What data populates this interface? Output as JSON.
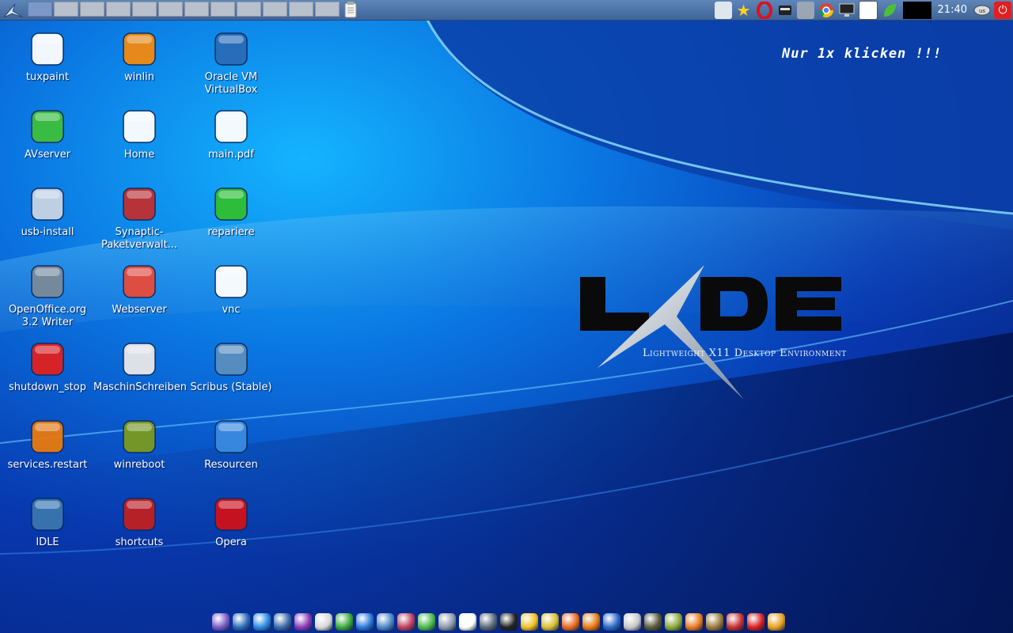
{
  "panel": {
    "pager_count": 12,
    "active_pager": 0,
    "clock": "21:40",
    "tray_icons": [
      "network-icon",
      "bookmark-star-icon",
      "opera-icon",
      "removable-drive-icon",
      "file-cabinet-icon",
      "chrome-icon",
      "display-icon",
      "cloud-icon",
      "leaf-icon",
      "system-monitor-icon",
      "language-icon",
      "power-icon"
    ]
  },
  "desktop": {
    "message": "Nur 1x klicken !!!",
    "logo_text": "LXDE",
    "logo_subtitle": "Lightweight X11 Desktop Environment",
    "icons": [
      {
        "label": "tuxpaint",
        "icon": "tux-penguin-icon",
        "color": "#ffffff"
      },
      {
        "label": "winlin",
        "icon": "worm-icon",
        "color": "#f08a10"
      },
      {
        "label": "Oracle VM VirtualBox",
        "icon": "virtualbox-cube-icon",
        "color": "#2a6cb8"
      },
      {
        "label": "AVserver",
        "icon": "green-folder-icon",
        "color": "#3cbf3c"
      },
      {
        "label": "Home",
        "icon": "house-icon",
        "color": "#ffffff"
      },
      {
        "label": "main.pdf",
        "icon": "document-icon",
        "color": "#ffffff"
      },
      {
        "label": "usb-install",
        "icon": "usb-stick-icon",
        "color": "#c8d4e4"
      },
      {
        "label": "Synaptic-Paketverwalt...",
        "icon": "package-manager-icon",
        "color": "#c03030"
      },
      {
        "label": "repariere",
        "icon": "dropper-icon",
        "color": "#2fbf2f"
      },
      {
        "label": "OpenOffice.org 3.2 Writer",
        "icon": "writer-doc-icon",
        "color": "#7a8a9a"
      },
      {
        "label": "Webserver",
        "icon": "red-folder-icon",
        "color": "#e84a3a"
      },
      {
        "label": "vnc",
        "icon": "vnc-icon",
        "color": "#ffffff"
      },
      {
        "label": "shutdown_stop",
        "icon": "shutdown-icon",
        "color": "#e02020"
      },
      {
        "label": "MaschinSchreiben",
        "icon": "keyboard-keys-icon",
        "color": "#e8e8e8"
      },
      {
        "label": "Scribus (Stable)",
        "icon": "scribus-icon",
        "color": "#5a8fc0"
      },
      {
        "label": "services.restart",
        "icon": "xfce-x-icon",
        "color": "#e87a10"
      },
      {
        "label": "winreboot",
        "icon": "circuit-board-icon",
        "color": "#7a9a20"
      },
      {
        "label": "Resourcen",
        "icon": "resource-folder-icon",
        "color": "#3a8ae0"
      },
      {
        "label": "IDLE",
        "icon": "python-icon",
        "color": "#3a76b0"
      },
      {
        "label": "shortcuts",
        "icon": "exit-door-icon",
        "color": "#c02020"
      },
      {
        "label": "Opera",
        "icon": "opera-icon",
        "color": "#d0101a"
      }
    ]
  },
  "dock": {
    "icons": [
      {
        "name": "browser-icon",
        "color": "#7a5ac8"
      },
      {
        "name": "virtualbox-icon",
        "color": "#2a6cb8"
      },
      {
        "name": "teamviewer-icon",
        "color": "#2a8ae0"
      },
      {
        "name": "network-icon",
        "color": "#3a6aa8"
      },
      {
        "name": "nvu-icon",
        "color": "#8a3ab8"
      },
      {
        "name": "keyboard-icon",
        "color": "#d8d8d8"
      },
      {
        "name": "frog-icon",
        "color": "#3aa83a"
      },
      {
        "name": "kde-icon",
        "color": "#2a78d8"
      },
      {
        "name": "sphere-icon",
        "color": "#4a88c8"
      },
      {
        "name": "mail-icon",
        "color": "#c04060"
      },
      {
        "name": "leaf-icon",
        "color": "#4ab84a"
      },
      {
        "name": "file-cabinet-icon",
        "color": "#8a98a8"
      },
      {
        "name": "cloud-icon",
        "color": "#ffffff"
      },
      {
        "name": "calculator-icon",
        "color": "#5a6a7a"
      },
      {
        "name": "inkscape-icon",
        "color": "#222222"
      },
      {
        "name": "penguin-icon",
        "color": "#f0c020"
      },
      {
        "name": "gimp-icon",
        "color": "#d8c030"
      },
      {
        "name": "stamp-icon",
        "color": "#e86a20"
      },
      {
        "name": "blender-icon",
        "color": "#e87a10"
      },
      {
        "name": "globe-icon",
        "color": "#2a68c8"
      },
      {
        "name": "package-icon",
        "color": "#c8c8c8"
      },
      {
        "name": "smiley-icon",
        "color": "#5a5a3a"
      },
      {
        "name": "inkscape-d-icon",
        "color": "#8aa83a"
      },
      {
        "name": "drop-icon",
        "color": "#e87a20"
      },
      {
        "name": "circuit-icon",
        "color": "#9a7a3a"
      },
      {
        "name": "lifebuoy-icon",
        "color": "#c83030"
      },
      {
        "name": "acrobat-icon",
        "color": "#d82020"
      },
      {
        "name": "sun-hat-icon",
        "color": "#e8a020"
      }
    ]
  }
}
